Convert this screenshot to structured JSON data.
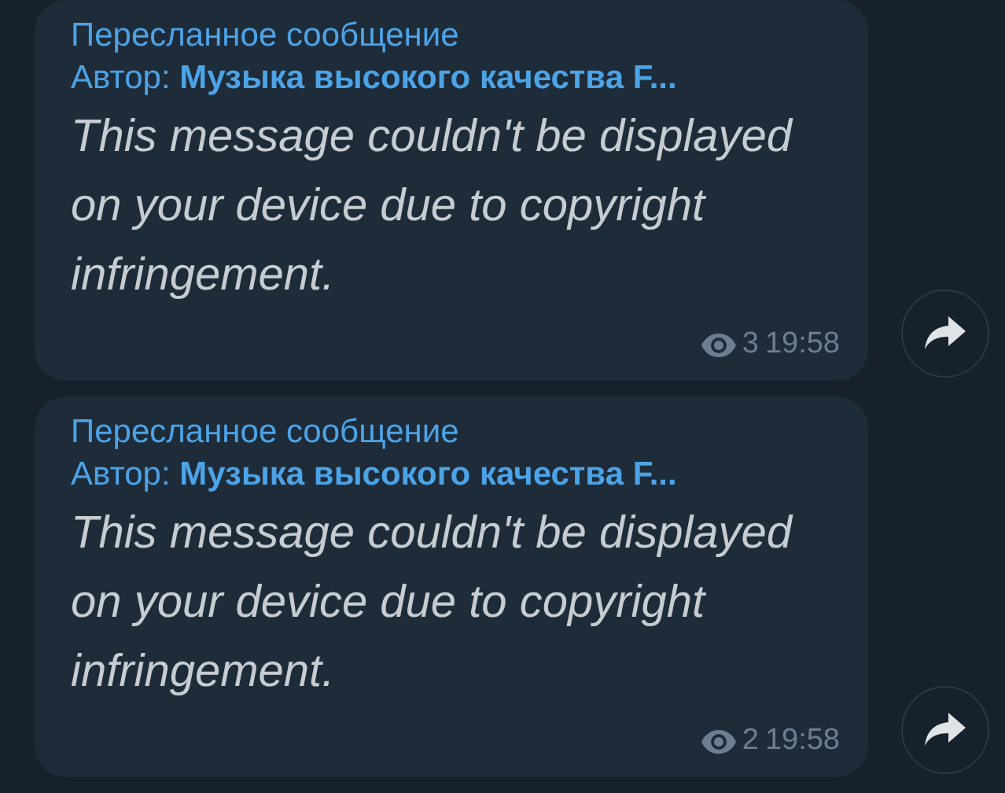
{
  "messages": [
    {
      "forwarded_label": "Пересланное сообщение",
      "author": "Автор: **Музыка высокого качества F...**",
      "text": "This message couldn't be displayed on your device due to copyright infringement.",
      "views": "3",
      "time": "19:58"
    },
    {
      "forwarded_label": "Пересланное сообщение",
      "author": "Автор: **Музыка высокого качества F...**",
      "text": "This message couldn't be displayed on your device due to copyright infringement.",
      "views": "2",
      "time": "19:58"
    }
  ]
}
